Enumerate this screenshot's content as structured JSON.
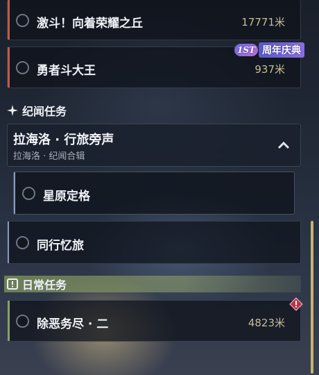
{
  "quests_top": [
    {
      "title": "激斗！向着荣耀之丘",
      "distance": "17771米"
    },
    {
      "title": "勇者斗大王",
      "distance": "937米"
    }
  ],
  "anniversary_badge": {
    "prefix": "1ST",
    "text": "周年庆典"
  },
  "lore_section": {
    "title": "纪闻任务",
    "group": {
      "title": "拉海洛 · 行旅旁声",
      "subtitle": "拉海洛 · 纪闻合辑"
    },
    "items": [
      {
        "title": "星原定格"
      },
      {
        "title": "同行忆旅"
      }
    ]
  },
  "daily_section": {
    "title": "日常任务",
    "items": [
      {
        "title": "除恶务尽 · 二",
        "distance": "4823米"
      }
    ]
  },
  "colors": {
    "trailblaze_accent": "#c05a48",
    "daily_accent": "#8aa06a",
    "lore_accent": "#8b98b5"
  }
}
